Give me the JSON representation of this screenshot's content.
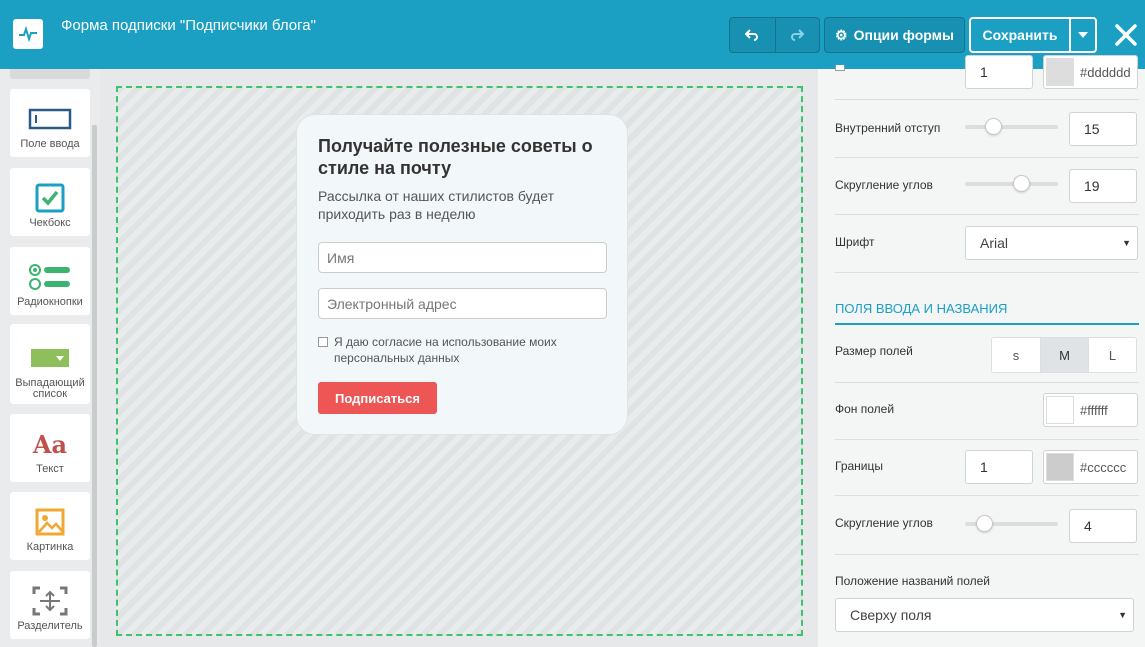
{
  "header": {
    "title": "Форма подписки \"Подписчики блога\"",
    "options_label": "Опции формы",
    "save_label": "Сохранить",
    "accent": "#1ba0c4"
  },
  "toolbox": {
    "items": [
      {
        "label": "Поле ввода",
        "icon": "input-field-icon"
      },
      {
        "label": "Чекбокс",
        "icon": "checkbox-icon"
      },
      {
        "label": "Радиокнопки",
        "icon": "radio-buttons-icon"
      },
      {
        "label": "Выпадающий список",
        "icon": "dropdown-icon"
      },
      {
        "label": "Текст",
        "icon": "text-icon",
        "glyph": "Aa"
      },
      {
        "label": "Картинка",
        "icon": "image-icon"
      },
      {
        "label": "Разделитель",
        "icon": "divider-icon"
      }
    ]
  },
  "form": {
    "heading": "Получайте полезные советы о стиле на почту",
    "subheading": "Рассылка от наших стилистов будет приходить раз в неделю",
    "name_placeholder": "Имя",
    "email_placeholder": "Электронный адрес",
    "consent": "Я даю согласие на использование моих персональных данных",
    "submit": "Подписаться",
    "submit_color": "#ee5555"
  },
  "panel": {
    "top_border_value": "1",
    "top_border_color": "#dddddd",
    "inner_padding_label": "Внутренний отступ",
    "inner_padding_value": "15",
    "corner_radius_label": "Скругление углов",
    "corner_radius_value": "19",
    "font_label": "Шрифт",
    "font_value": "Arial",
    "section_title": "ПОЛЯ ВВОДА И НАЗВАНИЯ",
    "field_size_label": "Размер полей",
    "field_sizes": [
      "s",
      "M",
      "L"
    ],
    "field_size_selected": "M",
    "field_bg_label": "Фон полей",
    "field_bg_value": "#ffffff",
    "borders_label": "Границы",
    "borders_width": "1",
    "borders_color": "#cccccc",
    "field_radius_label": "Скругление углов",
    "field_radius_value": "4",
    "label_position_label": "Положение названий полей",
    "label_position_value": "Сверху поля"
  }
}
